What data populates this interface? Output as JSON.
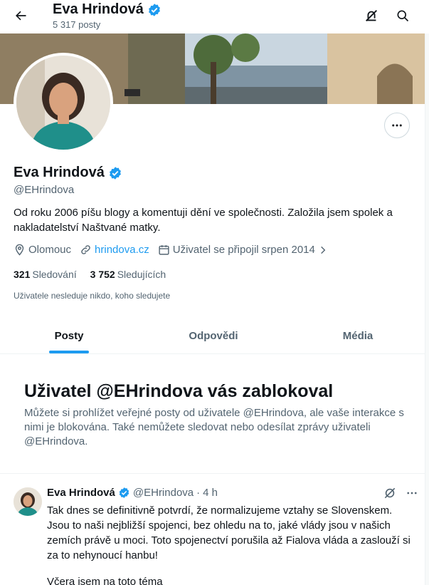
{
  "header": {
    "name": "Eva Hrindová",
    "posts_count": "5 317 posty"
  },
  "icons": {
    "back": "arrow-left-icon",
    "verified": "verified-badge-icon",
    "unmute": "muted-bell-icon",
    "search": "search-icon",
    "more": "more-horizontal-icon",
    "location": "location-pin-icon",
    "link": "link-icon",
    "calendar": "calendar-icon"
  },
  "colors": {
    "accent": "#1d9bf0",
    "text": "#0f1419",
    "secondary": "#536471",
    "border": "#eff3f4"
  },
  "profile": {
    "name": "Eva Hrindová",
    "handle": "@EHrindova",
    "bio": "Od roku 2006 píšu blogy a komentuji dění ve společnosti. Založila jsem spolek a nakladatelství Naštvané matky.",
    "location": "Olomouc",
    "website": "hrindova.cz",
    "joined": "Uživatel se připojil srpen 2014",
    "following_count": "321",
    "following_label": "Sledování",
    "followers_count": "3 752",
    "followers_label": "Sledujících",
    "not_followed_note": "Uživatele nesleduje nikdo, koho sledujete"
  },
  "tabs": [
    {
      "label": "Posty",
      "active": true
    },
    {
      "label": "Odpovědi",
      "active": false
    },
    {
      "label": "Média",
      "active": false
    }
  ],
  "blocked": {
    "title": "Uživatel @EHrindova vás zablokoval",
    "text": "Můžete si prohlížet veřejné posty od uživatele @EHrindova, ale vaše interakce s nimi je blokována. Také nemůžete sledovat nebo odesílat zprávy uživateli @EHrindova."
  },
  "tweet": {
    "name": "Eva Hrindová",
    "handle": "@EHrindova",
    "separator": "·",
    "time": "4 h",
    "text": "Tak dnes se definitivně potvrdí, že normalizujeme vztahy se Slovenskem. Jsou to naši nejbližší spojenci, bez ohledu na to, jaké vlády jsou v našich zemích právě u moci. Toto spojenectví porušila až Fialova vláda a zaslouží si za to nehynoucí hanbu!",
    "text_cont": "Včera jsem na toto téma"
  }
}
